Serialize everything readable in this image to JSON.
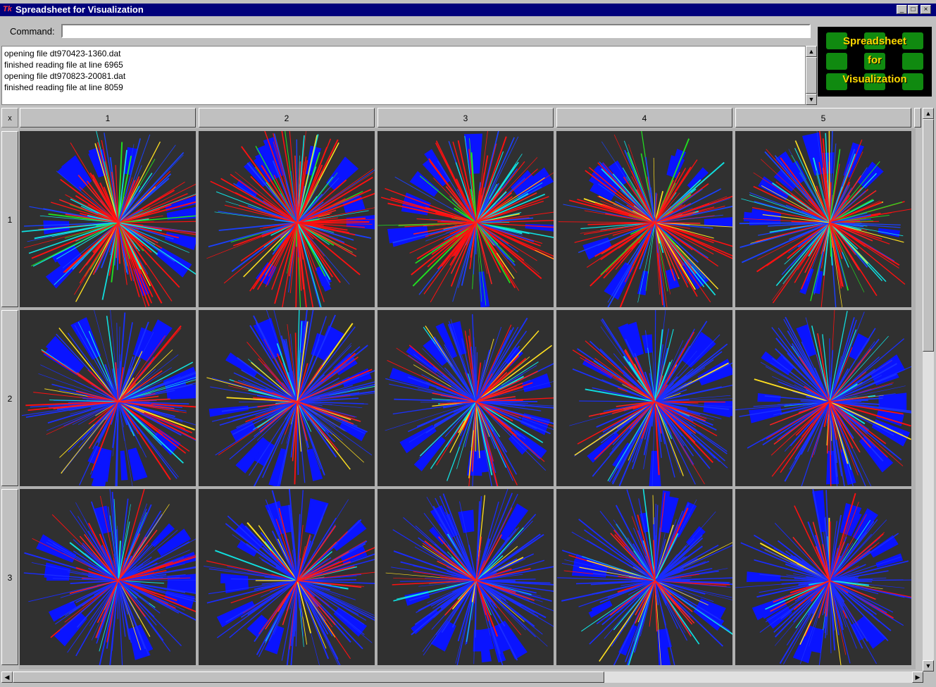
{
  "window": {
    "title": "Spreadsheet for Visualization",
    "app_icon": "Tk"
  },
  "command": {
    "label": "Command:",
    "value": ""
  },
  "log": {
    "lines": [
      "opening file dt970423-1360.dat",
      "finished reading file at line 6965",
      "opening file dt970823-20081.dat",
      "finished reading file at line 8059"
    ]
  },
  "logo": {
    "line1": "Spreadsheet",
    "line2": "for",
    "line3": "Visualization"
  },
  "grid": {
    "corner_label": "x",
    "columns": [
      "1",
      "2",
      "3",
      "4",
      "5"
    ],
    "rows": [
      "1",
      "2",
      "3"
    ]
  },
  "colors": {
    "titlebar": "#00007b",
    "cell_background": "#303030",
    "logo_text": "#ffd800",
    "logo_tile": "#108a10"
  }
}
